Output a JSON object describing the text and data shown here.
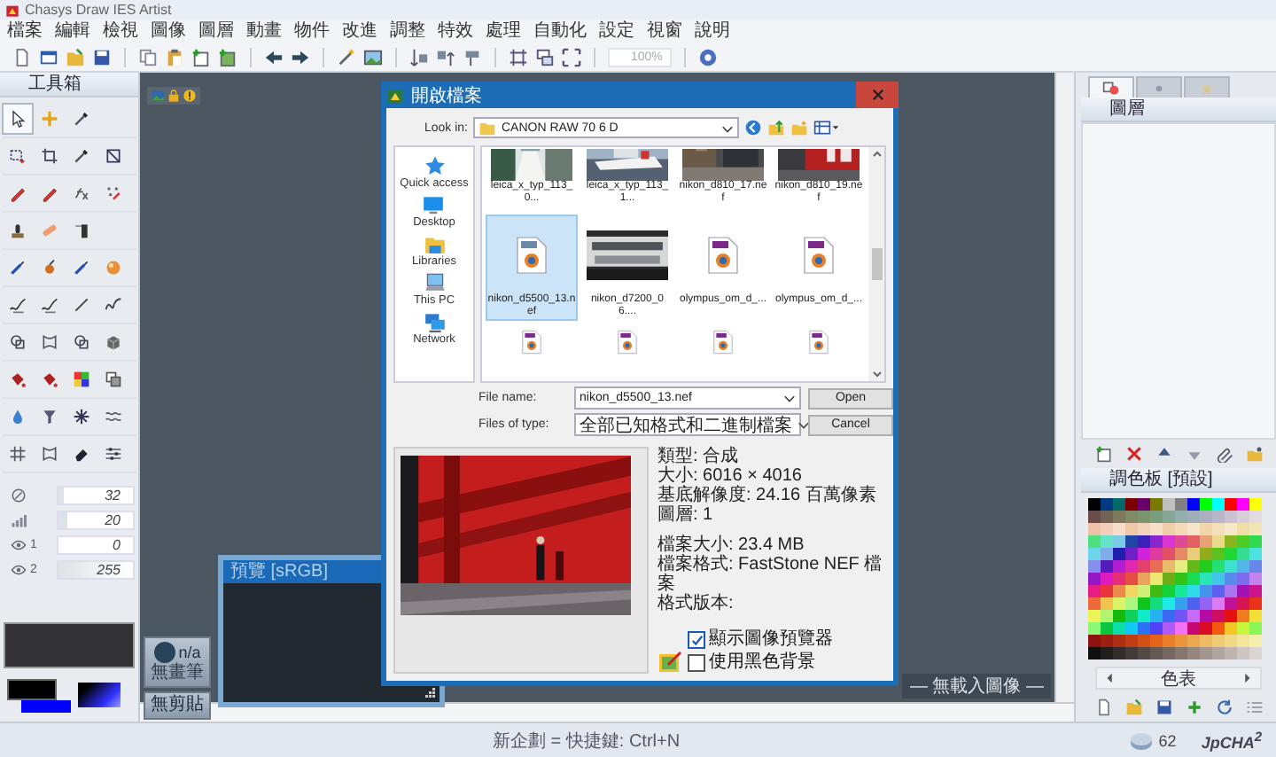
{
  "window": {
    "title": "Chasys Draw IES Artist"
  },
  "menu": [
    "檔案",
    "編輯",
    "檢視",
    "圖像",
    "圖層",
    "動畫",
    "物件",
    "改進",
    "調整",
    "特效",
    "處理",
    "自動化",
    "設定",
    "視窗",
    "說明"
  ],
  "toolbar": {
    "zoom": "100%"
  },
  "toolbox": {
    "title": "工具箱",
    "tool_rows": [
      [
        {
          "kind": "pointer",
          "selected": true
        },
        {
          "kind": "move",
          "selected": false
        },
        {
          "kind": "dropper",
          "selected": false
        }
      ],
      [
        {
          "kind": "select",
          "selected": false
        },
        {
          "kind": "crop",
          "selected": false
        },
        {
          "kind": "dropper",
          "selected": false
        },
        {
          "kind": "resize",
          "selected": false
        }
      ],
      [
        {
          "kind": "pencil",
          "selected": false
        },
        {
          "kind": "pencil",
          "selected": false
        },
        {
          "kind": "fx",
          "selected": false
        },
        {
          "kind": "scatter",
          "selected": false
        }
      ],
      [
        {
          "kind": "stamp",
          "selected": false
        },
        {
          "kind": "bandage",
          "selected": false
        },
        {
          "kind": "tube",
          "selected": false
        }
      ],
      [
        {
          "kind": "brush",
          "selected": false
        },
        {
          "kind": "smudge",
          "selected": false
        },
        {
          "kind": "brush",
          "selected": false
        },
        {
          "kind": "ball",
          "selected": false
        }
      ],
      [
        {
          "kind": "signature",
          "selected": false
        },
        {
          "kind": "signature",
          "selected": false
        },
        {
          "kind": "line",
          "selected": false
        },
        {
          "kind": "curve",
          "selected": false
        }
      ],
      [
        {
          "kind": "shapes",
          "selected": false
        },
        {
          "kind": "warp",
          "selected": false
        },
        {
          "kind": "shapes",
          "selected": false
        },
        {
          "kind": "cube",
          "selected": false
        }
      ],
      [
        {
          "kind": "bucket",
          "selected": false
        },
        {
          "kind": "bucket",
          "selected": false
        },
        {
          "kind": "gradient",
          "selected": false
        },
        {
          "kind": "squares",
          "selected": false
        }
      ],
      [
        {
          "kind": "drop",
          "selected": false
        },
        {
          "kind": "funnel",
          "selected": false
        },
        {
          "kind": "burst",
          "selected": false
        },
        {
          "kind": "wave",
          "selected": false
        }
      ],
      [
        {
          "kind": "hash",
          "selected": false
        },
        {
          "kind": "warp",
          "selected": false
        },
        {
          "kind": "eraser",
          "selected": false
        },
        {
          "kind": "sliders",
          "selected": false
        }
      ]
    ],
    "fields": [
      {
        "kind": "size",
        "value": "32",
        "level": 0.08
      },
      {
        "kind": "strength",
        "value": "20",
        "level": 0.12
      },
      {
        "kind": "eye",
        "label": "1",
        "value": "0"
      },
      {
        "kind": "eye",
        "label": "2",
        "value": "255",
        "level": 1
      }
    ]
  },
  "brush": {
    "label": "n/a",
    "caption": "無畫筆"
  },
  "clipboard": {
    "label": "無剪貼"
  },
  "preview_window": {
    "title": "預覽 [sRGB]"
  },
  "canvas_note": "— 無載入圖像 —",
  "dialog": {
    "title": "開啟檔案",
    "look_in_label": "Look in:",
    "look_in": "CANON RAW 70 6 D",
    "places": [
      {
        "kind": "star",
        "label": "Quick access"
      },
      {
        "kind": "desktop",
        "label": "Desktop"
      },
      {
        "kind": "folder",
        "label": "Libraries"
      },
      {
        "kind": "pc",
        "label": "This PC"
      },
      {
        "kind": "network",
        "label": "Network"
      }
    ],
    "files": [
      {
        "name": "leica_x_typ_113_0...",
        "selected": false
      },
      {
        "name": "leica_x_typ_113_1...",
        "selected": false
      },
      {
        "name": "nikon_d810_17.nef",
        "selected": false
      },
      {
        "name": "nikon_d810_19.nef",
        "selected": false
      },
      {
        "kind": "raw",
        "name": "nikon_d5500_13.nef",
        "selected": true
      },
      {
        "name": "nikon_d7200_06....",
        "selected": false
      },
      {
        "kind": "raw",
        "name": "olympus_om_d_...",
        "selected": false
      },
      {
        "kind": "raw",
        "name": "olympus_om_d_...",
        "selected": false
      },
      {
        "kind": "raw",
        "selected": false
      },
      {
        "kind": "raw",
        "selected": false
      },
      {
        "kind": "raw",
        "selected": false
      },
      {
        "kind": "raw",
        "selected": false
      }
    ],
    "file_name_label": "File name:",
    "file_name": "nikon_d5500_13.nef",
    "type_label": "Files of type:",
    "file_type": "全部已知格式和二進制檔案",
    "buttons": [
      "Open",
      "Cancel"
    ],
    "info_groups": [
      [
        "類型: 合成",
        "大小: 6016 × 4016",
        "基底解像度: 24.16 百萬像素",
        "圖層: 1"
      ],
      [
        "檔案大小: 23.4 MB",
        "檔案格式: FastStone NEF 檔案",
        "格式版本:"
      ]
    ],
    "options": [
      {
        "label": "顯示圖像預覽器",
        "checked": true
      },
      {
        "label": "使用黑色背景",
        "checked": false
      }
    ]
  },
  "side_panel": {
    "tabs": [
      {
        "selected": true
      },
      {
        "selected": false
      },
      {
        "selected": false
      }
    ],
    "layers_title": "圖層",
    "palette_title": "調色板 [預設]",
    "palette_name": "色表"
  },
  "status_bar": {
    "hint": "新企劃 = 快捷鍵: Ctrl+N",
    "count": "62",
    "brand": "JpCHA$^{2}$"
  }
}
